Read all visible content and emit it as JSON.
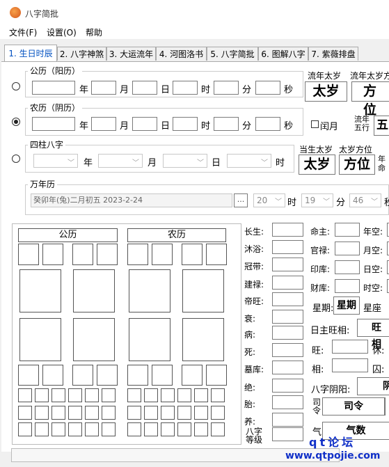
{
  "window": {
    "title": "八字简批"
  },
  "menu": [
    "文件(F)",
    "设置(O)",
    "帮助"
  ],
  "tabs": [
    "1. 生日时辰",
    "2. 八字神煞",
    "3. 大运流年",
    "4. 河图洛书",
    "5. 八字简批",
    "6. 图解八字",
    "7. 紫薇排盘"
  ],
  "solar": {
    "group_label": "公历（阳历）",
    "units": [
      "年",
      "月",
      "日",
      "时",
      "分",
      "秒"
    ]
  },
  "lunar": {
    "group_label": "农历（阴历）",
    "units": [
      "年",
      "月",
      "日",
      "时",
      "分",
      "秒"
    ],
    "leap_label": "闰月"
  },
  "pillars": {
    "group_label": "四柱八字",
    "units": [
      "年",
      "月",
      "日",
      "时"
    ]
  },
  "wannianli": {
    "group_label": "万年历",
    "date_text": "癸卯年(兔)二月初五  2023-2-24",
    "ellipsis": "...",
    "hour": "20",
    "minute": "19",
    "second": "46",
    "hour_label": "时",
    "minute_label": "分",
    "second_label": "秒"
  },
  "right_panel": {
    "liunian_taisui_label": "流年太岁",
    "liunian_taisui_value": "太岁",
    "liunian_taisui_dir_label": "流年太岁方",
    "liunian_taisui_dir_value": "方位",
    "liunian_wuxing_label": "流年五行",
    "liunian_wuxing_value": "五",
    "dangsheng_taisui_label": "当生太岁",
    "dangsheng_taisui_value": "太岁",
    "taisui_dir_label": "太岁方位",
    "taisui_dir_value": "方位",
    "nianming_label": "年命"
  },
  "chart_headers": {
    "solar": "公历",
    "lunar": "农历"
  },
  "stages": [
    "长生:",
    "沐浴:",
    "冠带:",
    "建禄:",
    "帝旺:",
    "衰:",
    "病:",
    "死:",
    "墓库:",
    "绝:",
    "胎:",
    "养:",
    "八字等级"
  ],
  "palaces": [
    "命主:",
    "官禄:",
    "印库:",
    "财库:"
  ],
  "voids": [
    "年空:",
    "月空:",
    "日空:",
    "时空:"
  ],
  "week": {
    "label": "星期:",
    "value": "星期",
    "xingzuo_label": "星座"
  },
  "rizhu": {
    "label": "日主旺相:",
    "value": "旺相"
  },
  "wang_label": "旺:",
  "xiu_label": "休:",
  "xiang_label": "相:",
  "qiu_label": "囚:",
  "yinyang": {
    "label": "八字阴阳:",
    "value": "阴"
  },
  "siling": {
    "label": "司令",
    "value": "司令"
  },
  "qi": {
    "label": "气",
    "value": "气数"
  },
  "watermark": {
    "top": "qt论坛",
    "bottom": "www.qtpojie.com"
  }
}
